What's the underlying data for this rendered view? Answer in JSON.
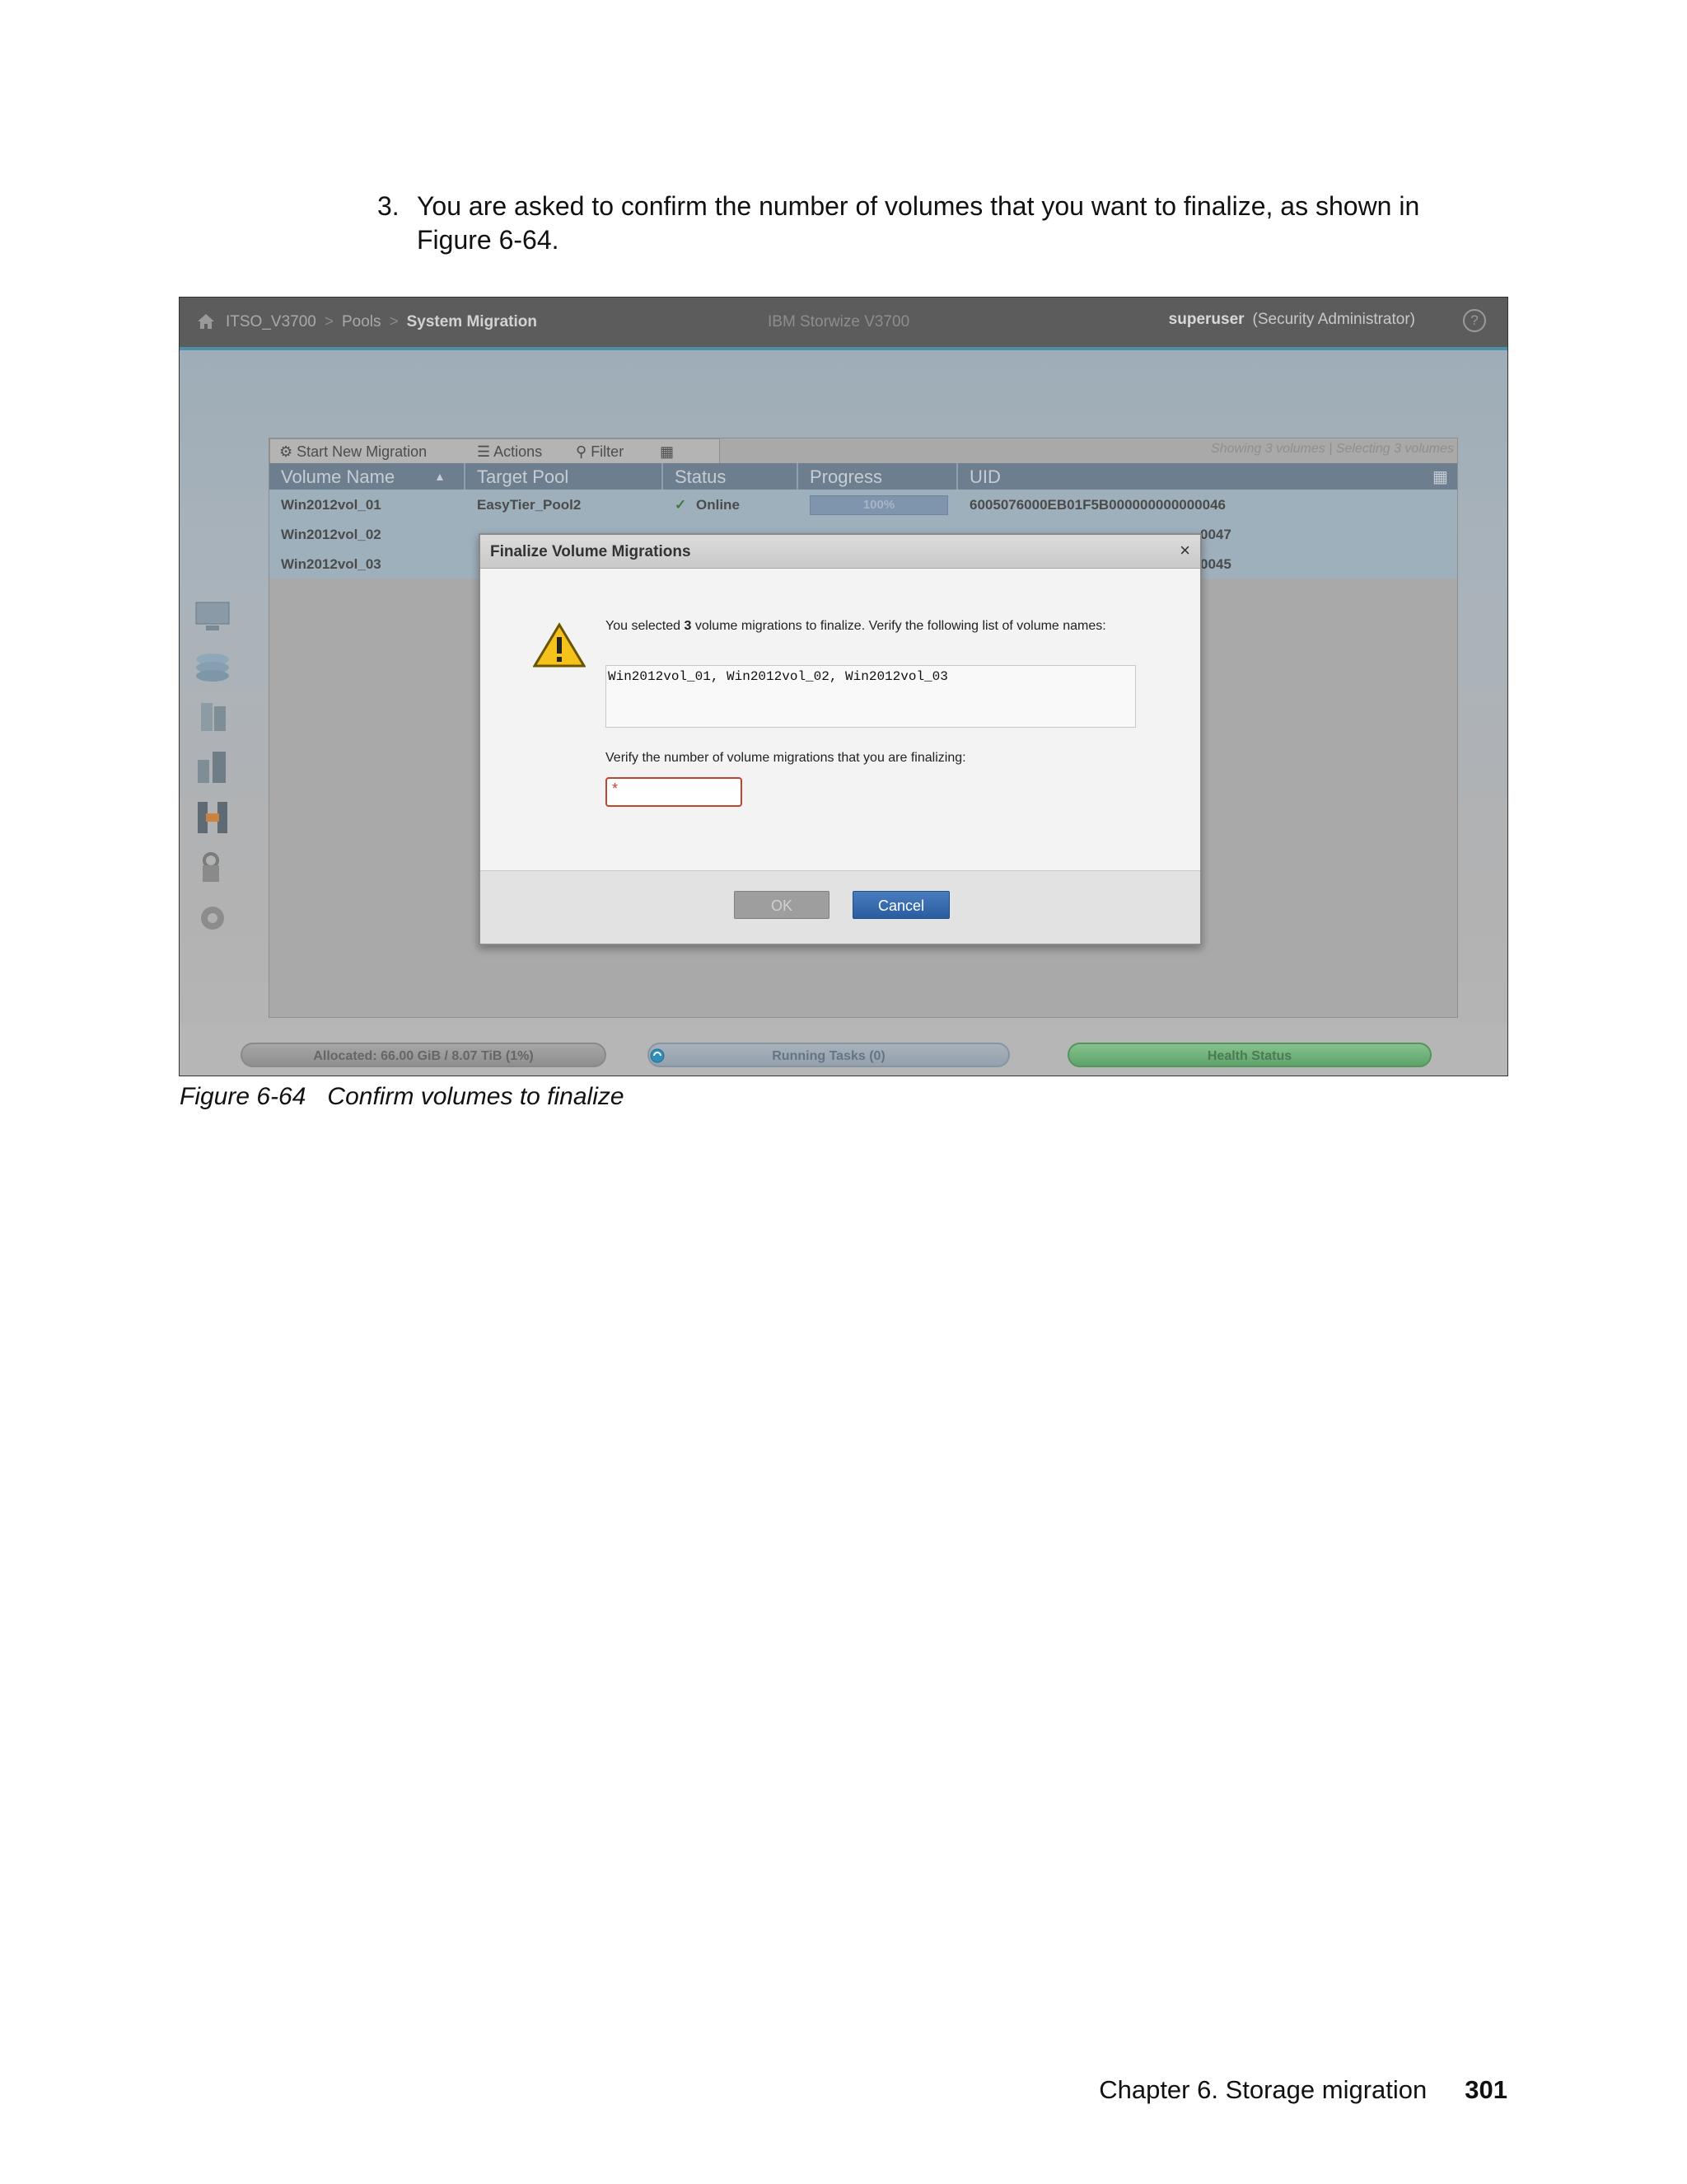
{
  "step": {
    "number": "3.",
    "text": "You are asked to confirm the number of volumes that you want to finalize, as shown in Figure 6-64."
  },
  "app": {
    "breadcrumb": [
      "ITSO_V3700",
      "Pools",
      "System Migration"
    ],
    "product": "IBM Storwize V3700",
    "user": "superuser",
    "role": "(Security Administrator)",
    "help_label": "?"
  },
  "toolbar": {
    "start_label": "Start New Migration",
    "actions_label": "Actions",
    "filter_label": "Filter",
    "showing_text": "Showing 3 volumes | Selecting 3 volumes"
  },
  "table": {
    "columns": [
      "Volume Name",
      "Target Pool",
      "Status",
      "Progress",
      "UID"
    ],
    "rows": [
      {
        "name": "Win2012vol_01",
        "pool": "EasyTier_Pool2",
        "status": "Online",
        "progress": "100%",
        "uid": "6005076000EB01F5B000000000000046"
      },
      {
        "name": "Win2012vol_02",
        "uid_tail": "0047"
      },
      {
        "name": "Win2012vol_03",
        "uid_tail": "0045"
      }
    ]
  },
  "dialog": {
    "title": "Finalize Volume Migrations",
    "close": "×",
    "message_pre": "You selected ",
    "message_count": "3",
    "message_post": " volume migrations to finalize. Verify the following list of volume names:",
    "volume_names": "Win2012vol_01, Win2012vol_02, Win2012vol_03",
    "verify_label": "Verify the number of volume migrations that you are finalizing:",
    "required_marker": "*",
    "ok_label": "OK",
    "cancel_label": "Cancel"
  },
  "statusbar": {
    "allocated": "Allocated: 66.00 GiB / 8.07 TiB (1%)",
    "tasks": "Running Tasks (0)",
    "health": "Health Status"
  },
  "caption": {
    "label": "Figure 6-64",
    "text": "Confirm volumes to finalize"
  },
  "footer": {
    "chapter": "Chapter 6. Storage migration",
    "page": "301"
  }
}
